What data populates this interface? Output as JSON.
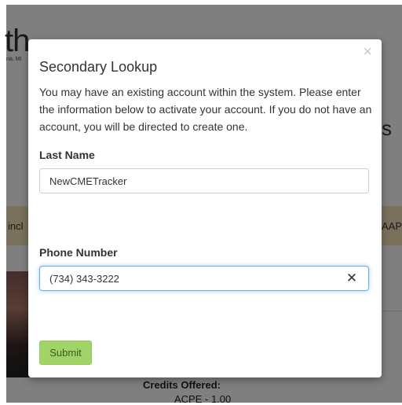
{
  "background": {
    "logo_fragment": "th",
    "logo_sub_fragment": "ria, MI",
    "title_fragment": "s",
    "band_left_fragment": "incl",
    "band_right_fragment": "AAP/",
    "credits_label": "Credits Offered:",
    "credits_first": "ACPE - 1.00"
  },
  "modal": {
    "title": "Secondary Lookup",
    "description": "You may have an existing account within the system. Please enter the information below to activate your account. If you do not have an account, you will be directed to create one.",
    "close_symbol": "×",
    "last_name": {
      "label": "Last Name",
      "value": "NewCMETracker"
    },
    "phone": {
      "label": "Phone Number",
      "value": "(734) 343-3222",
      "clear_symbol": "✕"
    },
    "submit_label": "Submit"
  },
  "colors": {
    "overlay": "#000000",
    "submit_bg": "#a0d468",
    "focus_border": "#66afe9",
    "band": "#f2e3b7"
  }
}
